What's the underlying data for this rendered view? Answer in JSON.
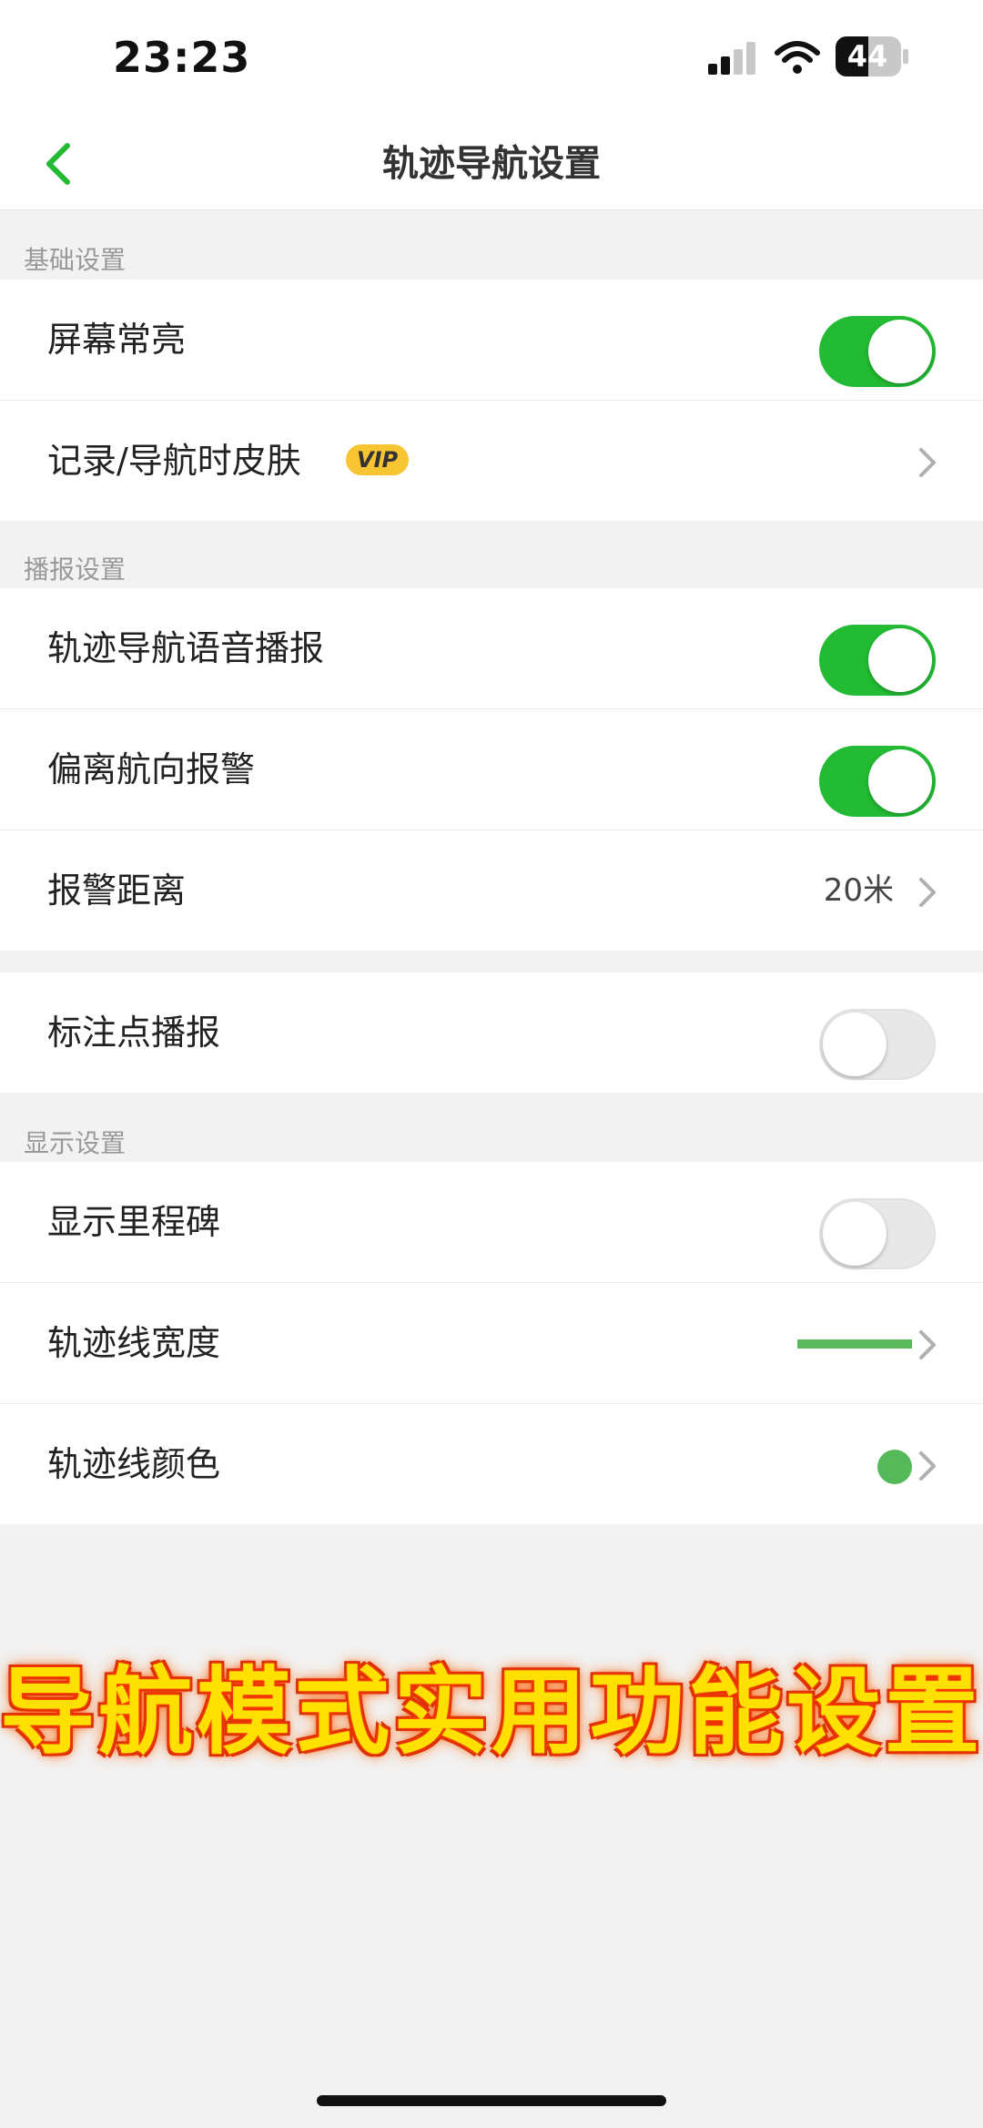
{
  "status_bar": {
    "time": "23:23",
    "battery_level": "44",
    "icons": [
      "signal-icon",
      "wifi-icon",
      "battery-icon"
    ]
  },
  "header": {
    "title": "轨迹导航设置",
    "back_icon": "chevron-left-icon"
  },
  "sections": {
    "basic": {
      "title": "基础设置",
      "rows": [
        {
          "label": "屏幕常亮",
          "toggle": "on"
        },
        {
          "label": "记录/导航时皮肤",
          "badge": "VIP"
        }
      ]
    },
    "broadcast": {
      "title": "播报设置",
      "rows": [
        {
          "label": "轨迹导航语音播报",
          "toggle": "on"
        },
        {
          "label": "偏离航向报警",
          "toggle": "on"
        },
        {
          "label": "报警距离",
          "value": "20米"
        }
      ]
    },
    "marker": {
      "rows": [
        {
          "label": "标注点播报",
          "toggle": "off"
        }
      ]
    },
    "display": {
      "title": "显示设置",
      "rows": [
        {
          "label": "显示里程碑",
          "toggle": "off"
        },
        {
          "label": "轨迹线宽度"
        },
        {
          "label": "轨迹线颜色"
        }
      ]
    }
  },
  "colors": {
    "accent": "#22bb33",
    "track_line": "#5cb85c",
    "vip_badge": "#f7c531",
    "banner_text": "#ffe000",
    "banner_outline": "#ff4800"
  },
  "overlay": {
    "caption": "导航模式实用功能设置"
  }
}
